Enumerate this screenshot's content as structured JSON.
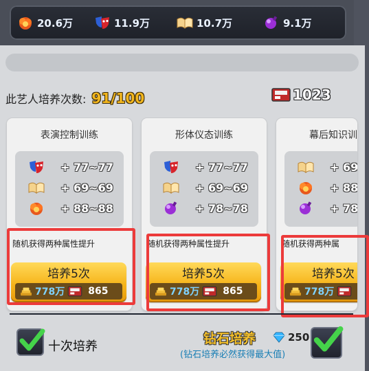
{
  "resources": [
    {
      "icon": "fire-burst-icon",
      "value": "20.6万"
    },
    {
      "icon": "mask-icon",
      "value": "11.9万"
    },
    {
      "icon": "book-icon",
      "value": "10.7万"
    },
    {
      "icon": "potion-icon",
      "value": "9.1万"
    }
  ],
  "training": {
    "count_label": "此艺人培养次数:",
    "count_value": "91/100",
    "ticket_count": "1023"
  },
  "cards": [
    {
      "title": "表演控制训练",
      "stats": [
        {
          "icon": "mask-icon",
          "value": "+ 77~77"
        },
        {
          "icon": "book-icon",
          "value": "+ 69~69"
        },
        {
          "icon": "fire-burst-icon",
          "value": "+ 88~88"
        }
      ],
      "bonus": "随机获得两种属性提升",
      "button_label": "培养5次",
      "cost_gold": "778万",
      "cost_ticket": "865"
    },
    {
      "title": "形体仪态训练",
      "stats": [
        {
          "icon": "mask-icon",
          "value": "+ 77~77"
        },
        {
          "icon": "book-icon",
          "value": "+ 69~69"
        },
        {
          "icon": "potion-icon",
          "value": "+ 78~78"
        }
      ],
      "bonus": "随机获得两种属性提升",
      "button_label": "培养5次",
      "cost_gold": "778万",
      "cost_ticket": "865"
    },
    {
      "title": "幕后知识训",
      "stats": [
        {
          "icon": "book-icon",
          "value": "+ 69"
        },
        {
          "icon": "fire-burst-icon",
          "value": "+ 88"
        },
        {
          "icon": "potion-icon",
          "value": "+ 78"
        }
      ],
      "bonus": "随机获得两种属",
      "button_label": "培养5次",
      "cost_gold": "778万",
      "cost_ticket": ""
    }
  ],
  "bottom": {
    "ten_times_label": "十次培养",
    "diamond_title": "钻石培养",
    "diamond_cost": "250",
    "diamond_note": "(钻石培养必然获得最大值)"
  },
  "colors": {
    "gold_text": "#f2b61e",
    "gold_button": "#f6b51b",
    "highlight_red": "#ec3b3b",
    "note_blue": "#1a7fb5"
  }
}
